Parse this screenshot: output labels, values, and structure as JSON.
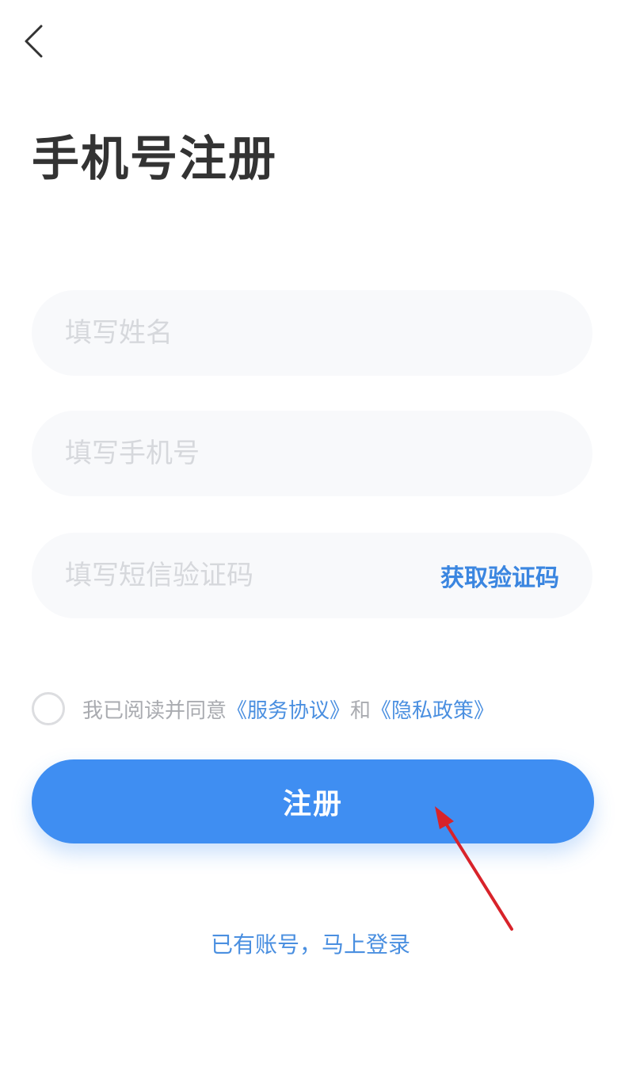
{
  "header": {
    "back_icon": "chevron-left-icon",
    "title": "手机号注册"
  },
  "form": {
    "name_placeholder": "填写姓名",
    "phone_placeholder": "填写手机号",
    "code_placeholder": "填写短信验证码",
    "get_code_label": "获取验证码"
  },
  "agreement": {
    "prefix": "我已阅读并同意",
    "service_link": "《服务协议》",
    "conjunction": "和",
    "privacy_link": "《隐私政策》",
    "checked": false
  },
  "register_button_label": "注册",
  "login_link_label": "已有账号，马上登录",
  "colors": {
    "accent": "#3f8ef2",
    "link": "#4a8fe0",
    "title": "#333333",
    "field_bg": "#f8f9fb",
    "annotation_arrow": "#d8232a"
  }
}
